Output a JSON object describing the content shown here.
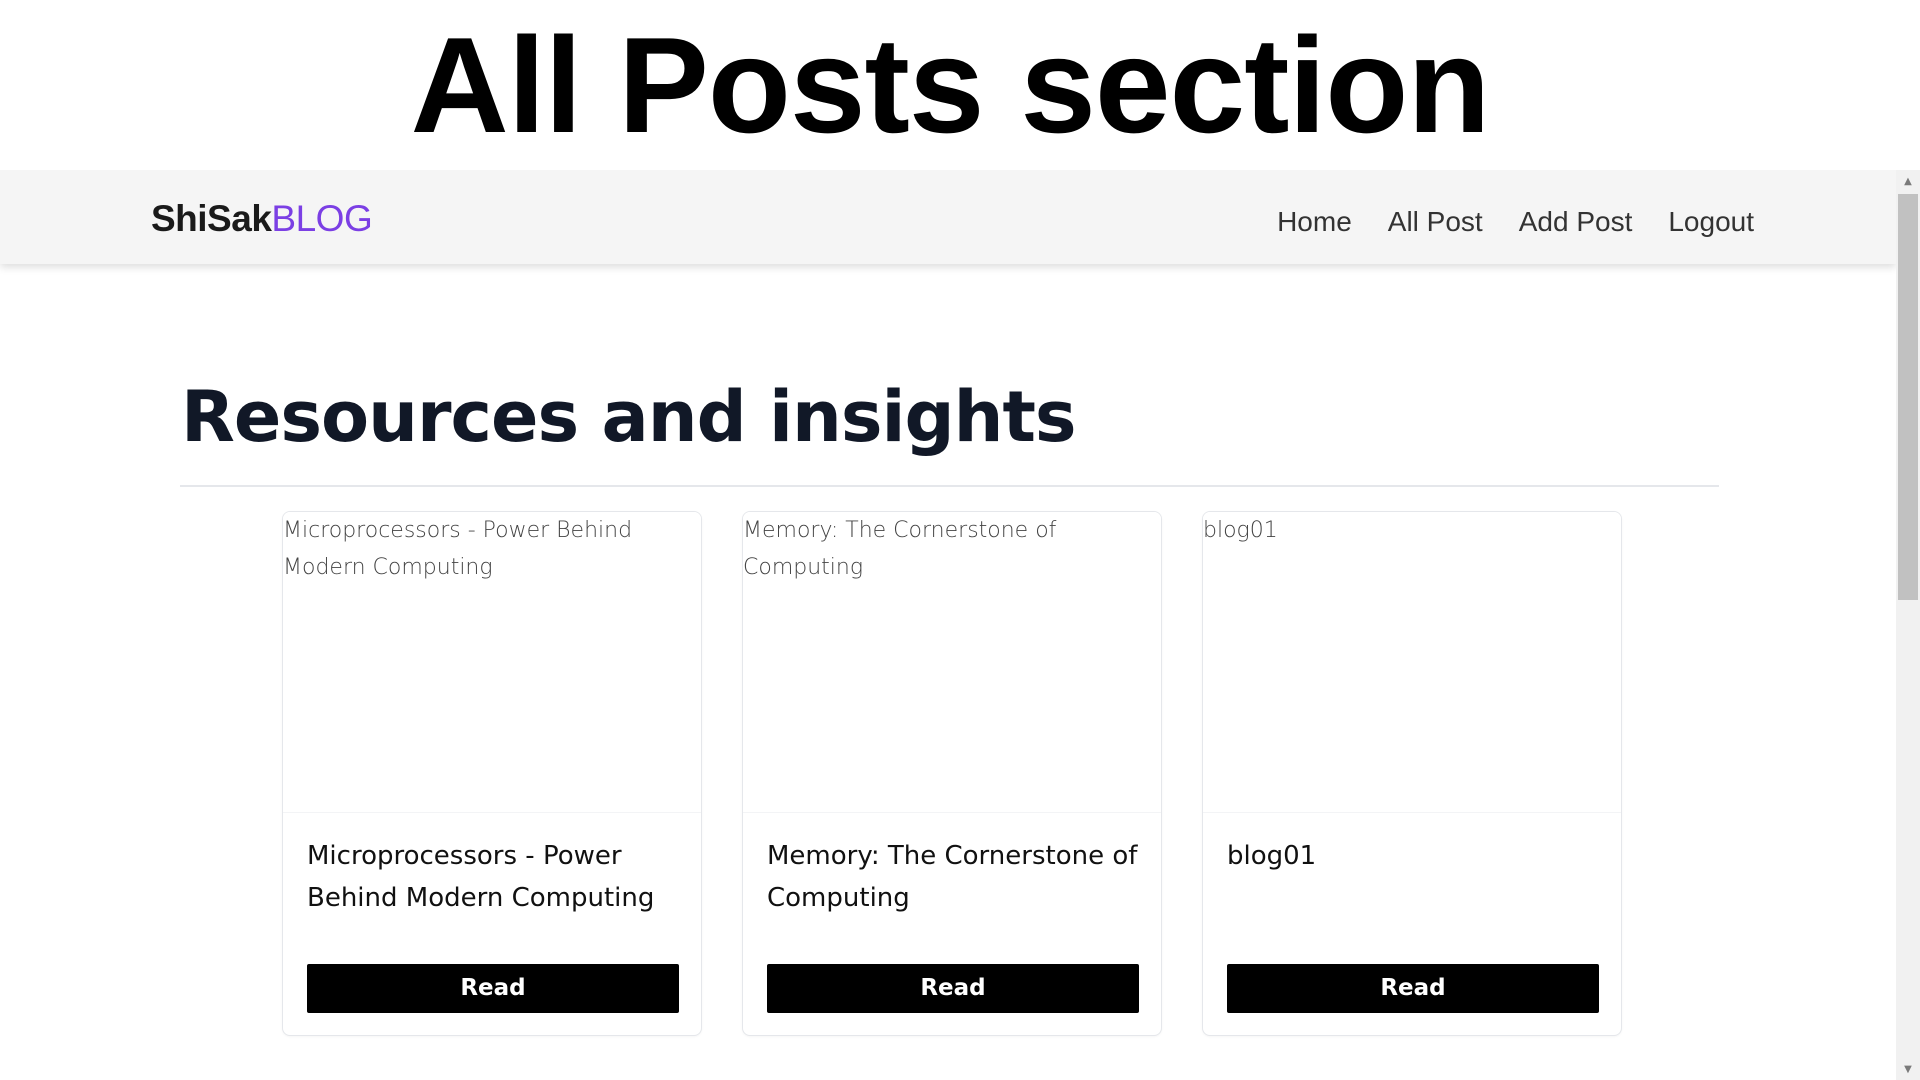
{
  "screen_title": "All Posts section",
  "navbar": {
    "brand_primary": "ShiSak",
    "brand_accent": "BLOG",
    "accent_color": "#7b3fe4",
    "links": [
      "Home",
      "All Post",
      "Add Post",
      "Logout"
    ]
  },
  "main": {
    "heading": "Resources and insights",
    "posts": [
      {
        "image_alt": "Microprocessors - Power Behind Modern Computing",
        "title": "Microprocessors - Power Behind Modern Computing",
        "button_label": "Read"
      },
      {
        "image_alt": "Memory: The Cornerstone of Computing",
        "title": "Memory: The Cornerstone of Computing",
        "button_label": "Read"
      },
      {
        "image_alt": "blog01",
        "title": "blog01",
        "button_label": "Read"
      }
    ]
  },
  "scrollbar": {
    "up_arrow_icon": "caret-up-icon",
    "down_arrow_icon": "caret-down-icon"
  }
}
